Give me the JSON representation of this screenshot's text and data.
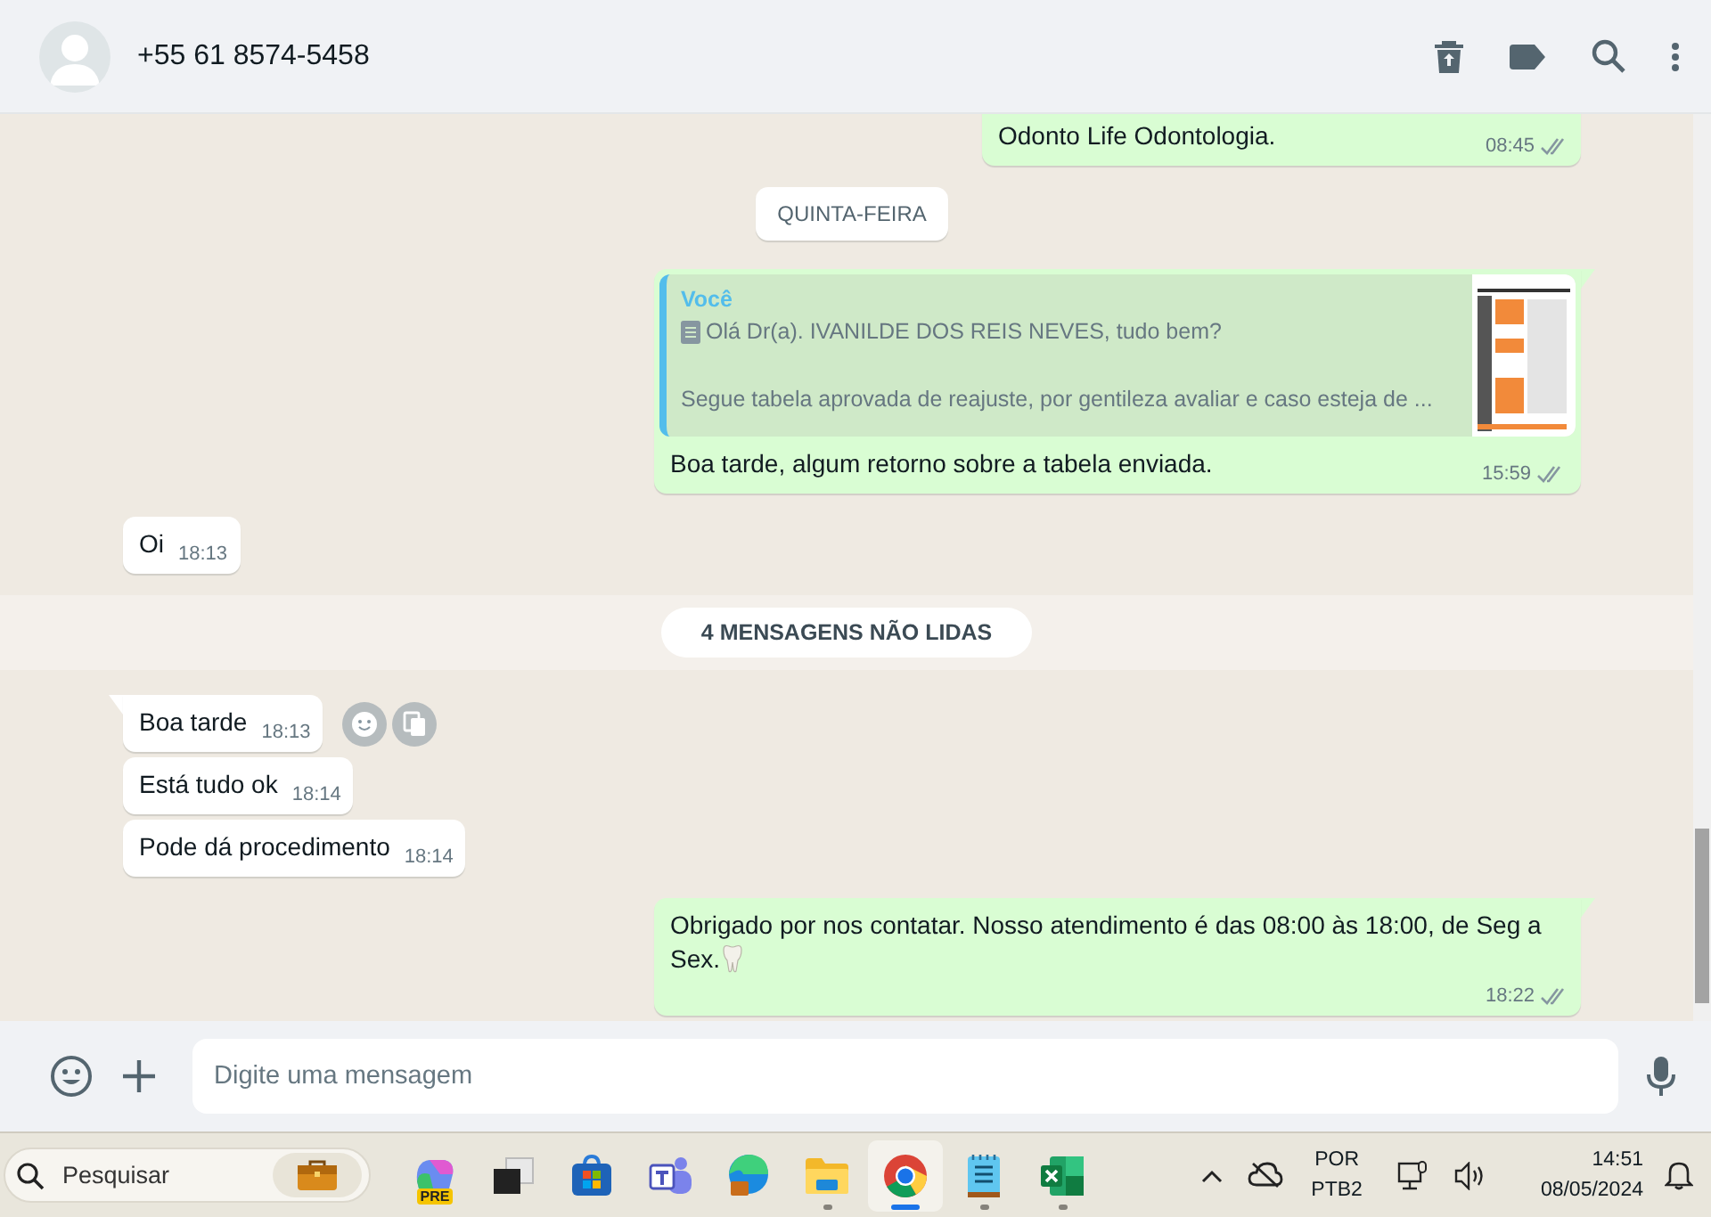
{
  "header": {
    "contact": "+55 61 8574-5458"
  },
  "messages": [
    {
      "kind": "outgoing",
      "text": "Odonto Life Odontologia.",
      "time": "08:45",
      "tail": false
    },
    {
      "kind": "date",
      "text": "QUINTA-FEIRA"
    },
    {
      "kind": "reply",
      "quote_author": "Você",
      "quote_lines": [
        "Olá Dr(a). IVANILDE DOS REIS NEVES, tudo bem?",
        "Segue tabela aprovada de reajuste, por gentileza avaliar e caso esteja de ..."
      ],
      "text": "Boa tarde, algum retorno sobre a tabela enviada.",
      "time": "15:59",
      "tail": true
    },
    {
      "kind": "incoming",
      "text": "Oi",
      "time": "18:13",
      "tail": false,
      "actions_visible": false
    },
    {
      "kind": "unread",
      "text": "4 MENSAGENS NÃO LIDAS"
    },
    {
      "kind": "incoming",
      "text": "Boa tarde",
      "time": "18:13",
      "tail": true,
      "actions_visible": true
    },
    {
      "kind": "incoming",
      "text": "Está tudo ok",
      "time": "18:14",
      "tail": false,
      "actions_visible": false
    },
    {
      "kind": "incoming",
      "text": "Pode dá procedimento",
      "time": "18:14",
      "tail": false,
      "actions_visible": false
    },
    {
      "kind": "outgoing",
      "text": "Obrigado por nos contatar. Nosso atendimento é das 08:00 às 18:00, de Seg a Sex.",
      "tooth_emoji": true,
      "time": "18:22",
      "tail": true
    }
  ],
  "composer": {
    "placeholder": "Digite uma mensagem"
  },
  "taskbar": {
    "search_placeholder": "Pesquisar",
    "apps": [
      {
        "kind": "copilot",
        "badge": "PRE",
        "running": false,
        "selected": false
      },
      {
        "kind": "taskview",
        "running": false,
        "selected": false
      },
      {
        "kind": "store",
        "running": false,
        "selected": false
      },
      {
        "kind": "teams",
        "running": false,
        "selected": false
      },
      {
        "kind": "edge",
        "running": false,
        "selected": false
      },
      {
        "kind": "folder",
        "running": true,
        "selected": false
      },
      {
        "kind": "chrome",
        "running": true,
        "selected": true
      },
      {
        "kind": "notepad",
        "running": true,
        "selected": false
      },
      {
        "kind": "excel",
        "running": true,
        "selected": false
      }
    ],
    "tray": {
      "language": "POR",
      "layout": "PTB2",
      "time": "14:51",
      "date": "08/05/2024"
    }
  }
}
